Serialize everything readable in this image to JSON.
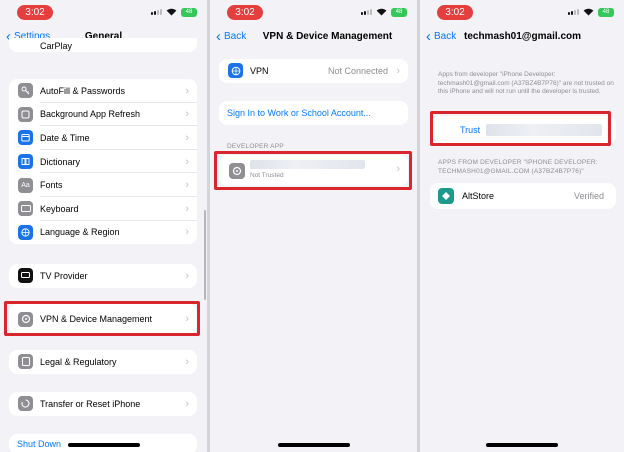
{
  "status": {
    "time": "3:02",
    "battery": "48"
  },
  "panel1": {
    "back_label": "Settings",
    "title": "General",
    "top_partial_label": "CarPlay",
    "group_a": [
      {
        "label": "AutoFill & Passwords",
        "icon": "key-icon",
        "color": "#8e8e93"
      },
      {
        "label": "Background App Refresh",
        "icon": "refresh-icon",
        "color": "#8e8e93"
      },
      {
        "label": "Date & Time",
        "icon": "calendar-icon",
        "color": "#1a73e8"
      },
      {
        "label": "Dictionary",
        "icon": "book-icon",
        "color": "#1a73e8"
      },
      {
        "label": "Fonts",
        "icon": "fonts-icon",
        "color": "#8e8e93"
      },
      {
        "label": "Keyboard",
        "icon": "keyboard-icon",
        "color": "#8e8e93"
      },
      {
        "label": "Language & Region",
        "icon": "globe-icon",
        "color": "#1a73e8"
      }
    ],
    "tv_provider": "TV Provider",
    "vpn_label": "VPN & Device Management",
    "legal": "Legal & Regulatory",
    "transfer": "Transfer or Reset iPhone",
    "shutdown": "Shut Down"
  },
  "panel2": {
    "back_label": "Back",
    "title": "VPN & Device Management",
    "vpn_label": "VPN",
    "vpn_status": "Not Connected",
    "signin_label": "Sign In to Work or School Account...",
    "developer_section": "DEVELOPER APP",
    "app_status": "Not Trusted"
  },
  "panel3": {
    "back_label": "Back",
    "title": "techmash01@gmail.com",
    "notice": "Apps from developer \"iPhone Developer: techmash01@gmail.com (A37BZ4B7P76)\" are not trusted on this iPhone and will not run until the developer is trusted.",
    "trust_label": "Trust",
    "apps_section": "APPS FROM DEVELOPER \"IPHONE DEVELOPER: TECHMASH01@GMAIL.COM (A37BZ4B7P76)\"",
    "app_name": "AltStore",
    "app_status": "Verified"
  },
  "colors": {
    "accent": "#007aff",
    "highlight": "#d9262c",
    "status_pill": "#e53e3e",
    "altstore": "#1a9b8e"
  }
}
